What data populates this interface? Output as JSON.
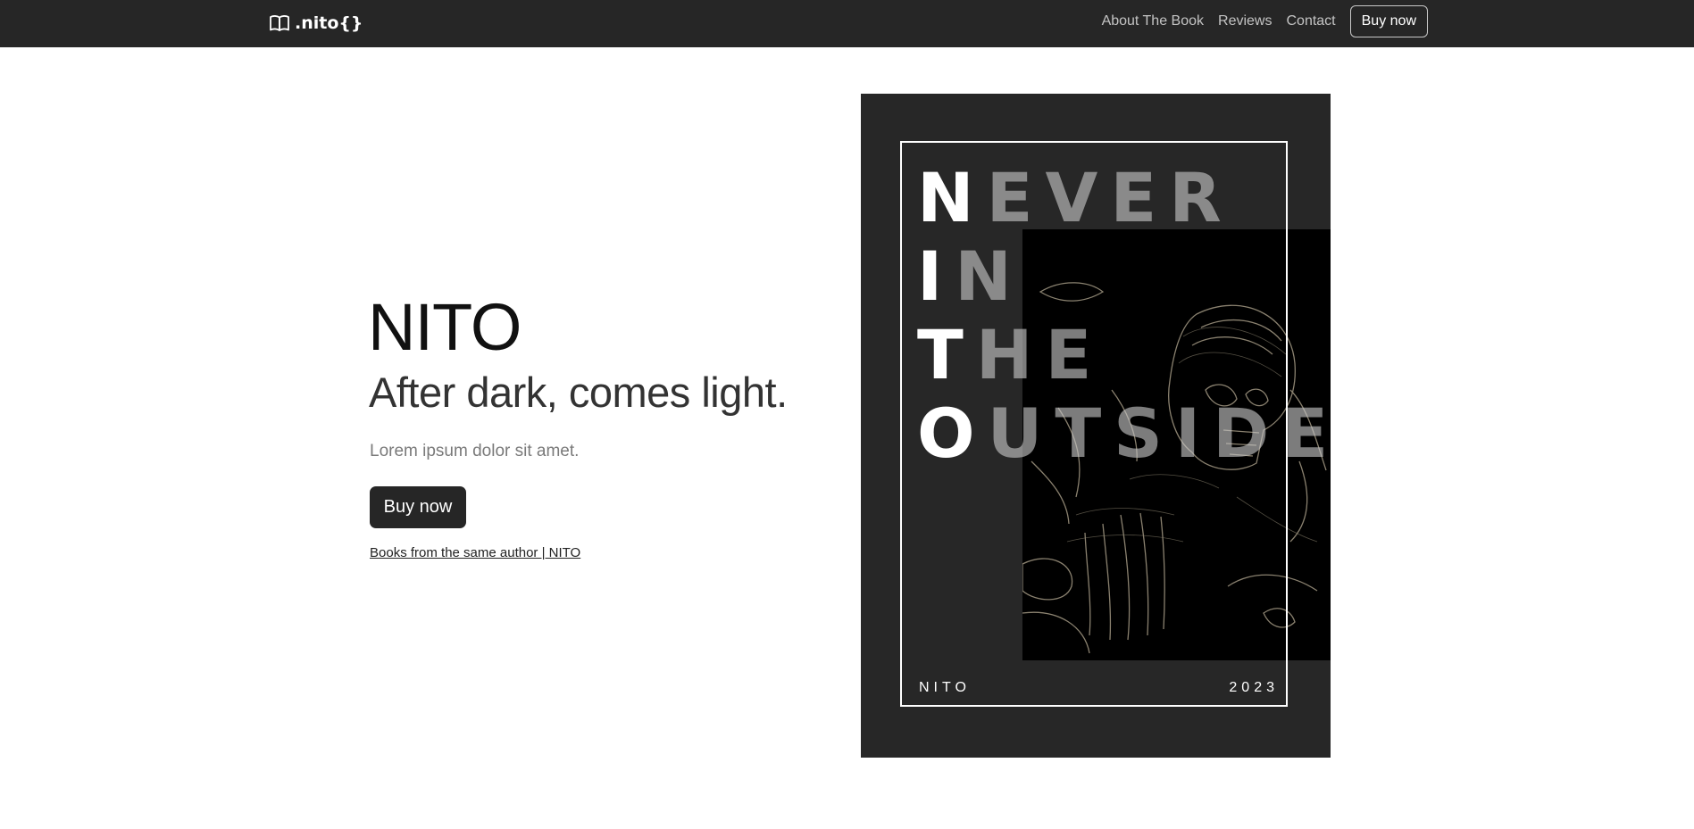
{
  "navbar": {
    "brand": ".nito{}",
    "brand_icon": "book-open-icon",
    "links": [
      "About The Book",
      "Reviews",
      "Contact"
    ],
    "cta": "Buy now"
  },
  "hero": {
    "title": "NITO",
    "subtitle": "After dark, comes light.",
    "lead": "Lorem ipsum dolor sit amet.",
    "button": "Buy now",
    "link": "Books from the same author | NITO"
  },
  "cover": {
    "words": [
      {
        "first": "N",
        "rest": "EVER"
      },
      {
        "first": "I",
        "rest": "N"
      },
      {
        "first": "T",
        "rest": "HE"
      },
      {
        "first": "O",
        "rest": "UTSIDE"
      }
    ],
    "author": "NITO",
    "year": "2023",
    "image": "skeleton-illustration"
  },
  "colors": {
    "navbar_bg": "#262626",
    "button_bg": "#262626",
    "cover_bg": "#272727"
  }
}
